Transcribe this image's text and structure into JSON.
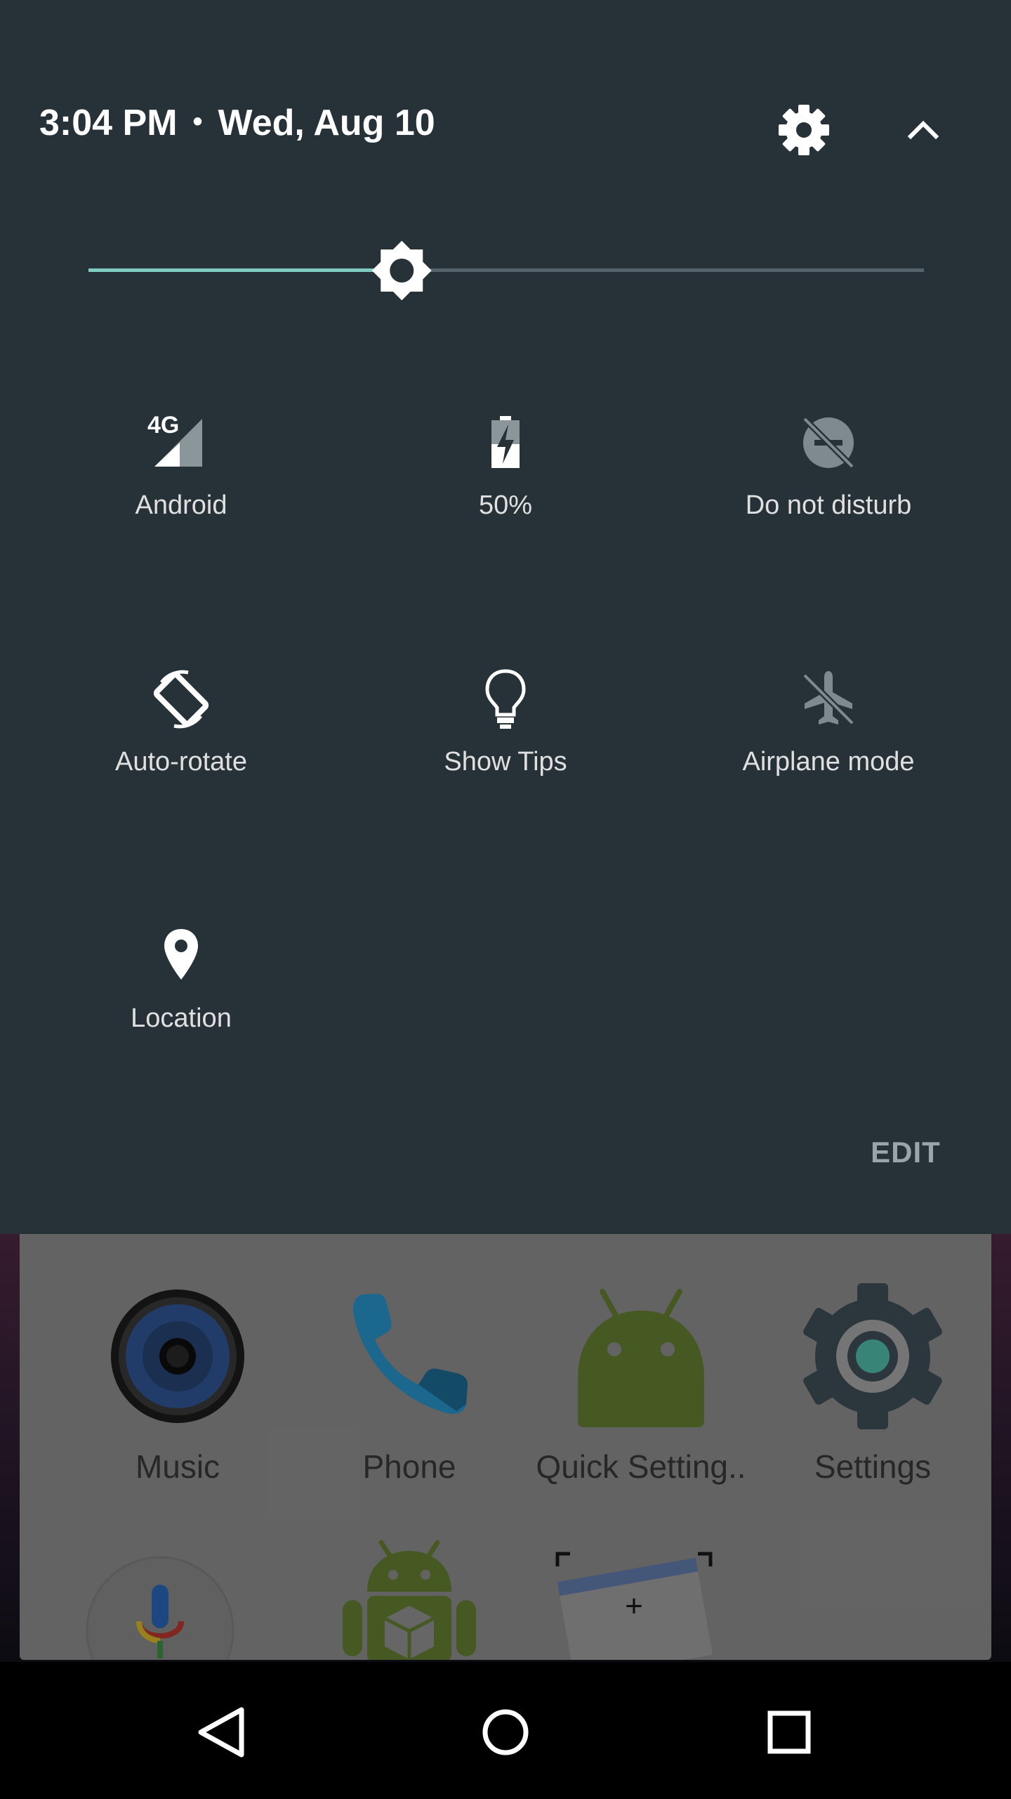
{
  "status": {
    "time": "3:04 PM",
    "separator": "•",
    "date": "Wed, Aug 10"
  },
  "header": {
    "settings_icon": "gear-icon",
    "collapse_icon": "chevron-up-icon"
  },
  "brightness": {
    "level": 0.375,
    "accent_color": "#80CBC4"
  },
  "tiles": [
    {
      "label": "Android",
      "icon": "cellular-4g-signal-icon",
      "active": true,
      "network": "4G"
    },
    {
      "label": "50%",
      "icon": "battery-charging-icon",
      "active": true
    },
    {
      "label": "Do not disturb",
      "icon": "do-not-disturb-off-icon",
      "active": false
    },
    {
      "label": "Auto-rotate",
      "icon": "screen-rotation-icon",
      "active": true
    },
    {
      "label": "Show Tips",
      "icon": "lightbulb-icon",
      "active": true
    },
    {
      "label": "Airplane mode",
      "icon": "airplane-off-icon",
      "active": false
    },
    {
      "label": "Location",
      "icon": "location-pin-icon",
      "active": true
    }
  ],
  "edit_label": "EDIT",
  "home": {
    "apps": [
      {
        "label": "Music",
        "icon": "speaker-icon"
      },
      {
        "label": "Phone",
        "icon": "phone-icon"
      },
      {
        "label": "Quick Setting..",
        "icon": "android-robot-icon"
      },
      {
        "label": "Settings",
        "icon": "settings-gear-icon"
      }
    ],
    "row2_icons": [
      "microphone-icon",
      "android-package-icon",
      "widget-add-icon"
    ],
    "widget_plus": "+"
  },
  "navbar": {
    "back_icon": "back-triangle-icon",
    "home_icon": "home-circle-icon",
    "recents_icon": "recents-square-icon"
  },
  "colors": {
    "shade_bg": "#263238",
    "active_icon": "#FFFFFF",
    "inactive_icon": "#7F8A90"
  }
}
